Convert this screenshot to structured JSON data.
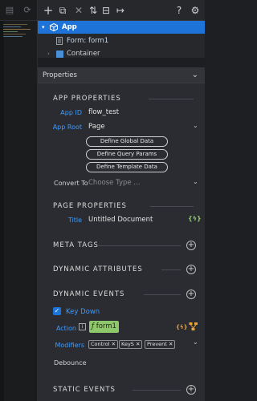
{
  "tree": {
    "root_label": "App",
    "items": [
      {
        "label": "Form: form1"
      },
      {
        "label": "Container"
      }
    ]
  },
  "properties_header": "Properties",
  "sections": {
    "app_properties": "APP PROPERTIES",
    "page_properties": "PAGE PROPERTIES",
    "meta_tags": "META TAGS",
    "dynamic_attributes": "DYNAMIC ATTRIBUTES",
    "dynamic_events": "DYNAMIC EVENTS",
    "static_events": "STATIC EVENTS"
  },
  "app": {
    "app_id_label": "App ID",
    "app_id_value": "flow_test",
    "app_root_label": "App Root",
    "app_root_value": "Page",
    "buttons": [
      "Define Global Data",
      "Define Query Params",
      "Define Template Data"
    ],
    "convert_to_label": "Convert To",
    "convert_to_placeholder": "Choose Type ..."
  },
  "page": {
    "title_label": "Title",
    "title_value": "Untitled Document"
  },
  "events": {
    "key_down_label": "Key Down",
    "key_down_checked": true,
    "action_label": "Action",
    "action_value": "form1",
    "modifiers_label": "Modifiers",
    "modifiers": [
      "Control",
      "KeyS",
      "Prevent"
    ],
    "debounce_label": "Debounce"
  },
  "colors": {
    "accent": "#1e73d8",
    "label_blue": "#3d9bff",
    "action_green": "#8fc76b"
  }
}
